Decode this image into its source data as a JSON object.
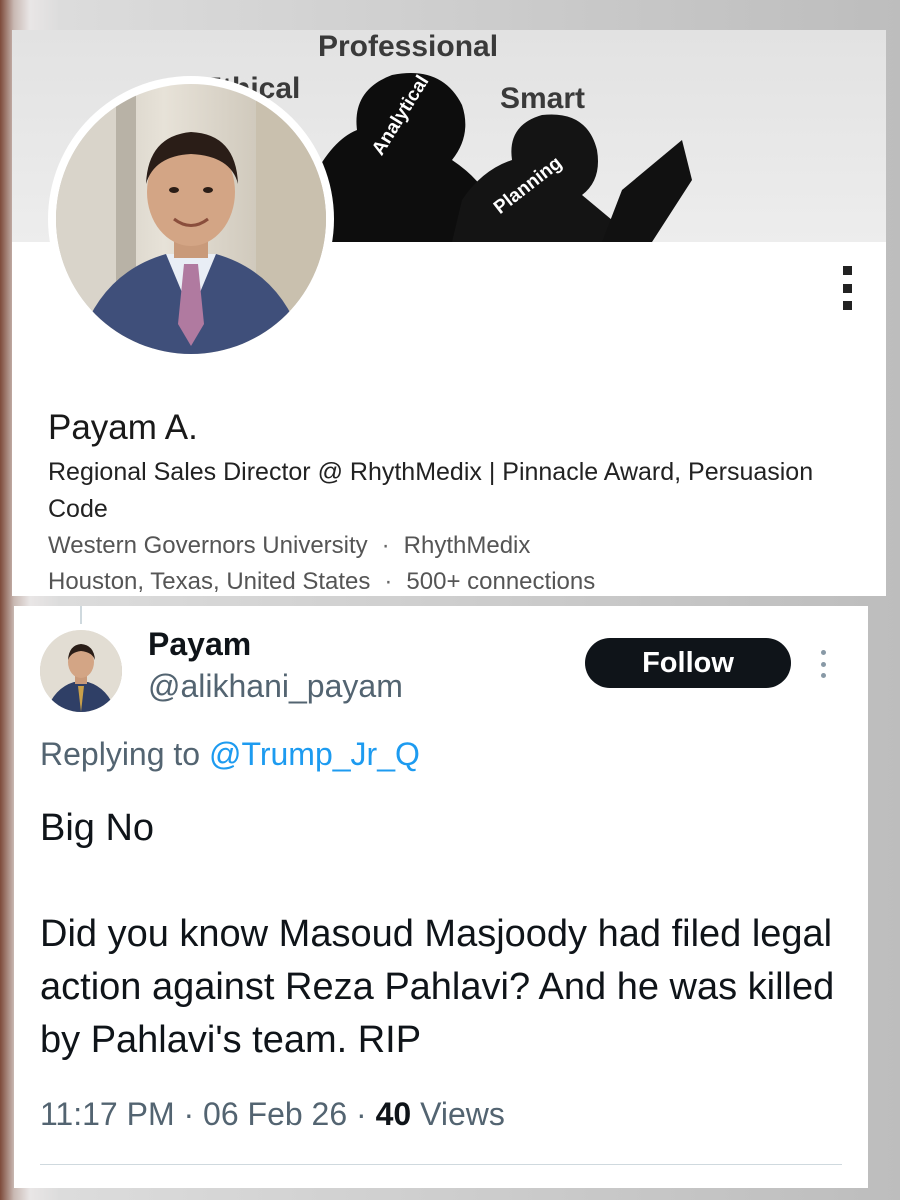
{
  "linkedin": {
    "banner_words": {
      "professional": "Professional",
      "ethical": "Ethical",
      "smart": "Smart",
      "analytical": "Analytical",
      "planning": "Planning"
    },
    "name": "Payam A.",
    "headline": "Regional Sales Director @ RhythMedix | Pinnacle Award, Persuasion Code",
    "education": "Western Governors University",
    "company": "RhythMedix",
    "location": "Houston, Texas, United States",
    "connections": "500+ connections",
    "separator": "·"
  },
  "tweet": {
    "display_name": "Payam",
    "handle": "@alikhani_payam",
    "follow_label": "Follow",
    "replying_prefix": "Replying to",
    "replying_to": "@Trump_Jr_Q",
    "paragraphs": [
      "Big No",
      "Did you know Masoud Masjoody had filed legal action against Reza Pahlavi? And he was killed by Pahlavi's team. RIP"
    ],
    "time": "11:17 PM",
    "date": "06 Feb 26",
    "views_count": "40",
    "views_label": "Views",
    "separator": "·"
  },
  "colors": {
    "follow_bg": "#0f1419",
    "mention": "#1d9bf0",
    "secondary_text": "#536471"
  }
}
